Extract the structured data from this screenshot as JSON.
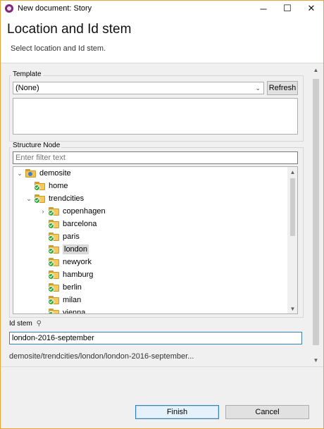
{
  "window": {
    "title": "New document: Story",
    "minimize_glyph": "─",
    "maximize_glyph": "☐",
    "close_glyph": "✕",
    "app_icon": "app-logo-icon"
  },
  "header": {
    "title": "Location and Id stem",
    "subtitle": "Select location and Id stem."
  },
  "template": {
    "group_label": "Template",
    "selected": "(None)",
    "refresh_label": "Refresh",
    "dropdown_glyph": "⌄"
  },
  "structure": {
    "group_label": "Structure Node",
    "filter_placeholder": "Enter filter text",
    "tree": [
      {
        "label": "demosite",
        "twisty": "⌄",
        "icon": "site-folder-icon"
      },
      {
        "label": "home",
        "twisty": "",
        "icon": "folder-check-icon"
      },
      {
        "label": "trendcities",
        "twisty": "⌄",
        "icon": "folder-check-icon"
      },
      {
        "label": "copenhagen",
        "twisty": "›",
        "icon": "folder-check-icon"
      },
      {
        "label": "barcelona",
        "twisty": "",
        "icon": "folder-check-icon"
      },
      {
        "label": "paris",
        "twisty": "",
        "icon": "folder-check-icon"
      },
      {
        "label": "london",
        "twisty": "",
        "icon": "folder-check-icon",
        "selected": true
      },
      {
        "label": "newyork",
        "twisty": "",
        "icon": "folder-check-icon"
      },
      {
        "label": "hamburg",
        "twisty": "",
        "icon": "folder-check-icon"
      },
      {
        "label": "berlin",
        "twisty": "",
        "icon": "folder-check-icon"
      },
      {
        "label": "milan",
        "twisty": "",
        "icon": "folder-check-icon"
      },
      {
        "label": "vienna",
        "twisty": "",
        "icon": "folder-check-icon"
      }
    ]
  },
  "idstem": {
    "label": "Id stem",
    "pin_glyph": "⚲",
    "value": "london-2016-september",
    "resulting_path": "demosite/trendcities/london/london-2016-september..."
  },
  "footer": {
    "finish_label": "Finish",
    "cancel_label": "Cancel"
  },
  "colors": {
    "window_border": "#e8a33c",
    "selection_bg": "#d9d9d9",
    "default_button_border": "#3c7fb1"
  }
}
